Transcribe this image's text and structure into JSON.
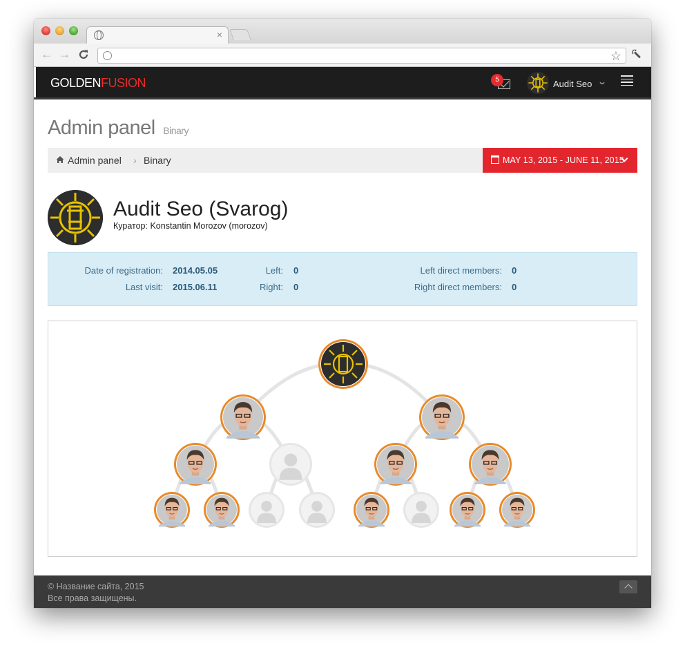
{
  "browser": {
    "tab_close": "×",
    "nav_back": "←",
    "nav_forward": "→",
    "reload": "C",
    "address": "",
    "bookmark_star": "☆",
    "wrench": "🔧"
  },
  "navbar": {
    "brand_golden": "GOLDEN",
    "brand_fusion": "FUSION",
    "brand_colors": {
      "golden": "#ffffff",
      "fusion": "#e52c2c"
    },
    "mail_count": "5",
    "user_name": "Audit Seo",
    "user_caret": "⌄",
    "icons": [
      "mail-icon",
      "avatar",
      "chevron-down-icon",
      "hamburger-icon"
    ]
  },
  "header": {
    "title": "Admin panel",
    "subtitle": "Binary"
  },
  "breadcrumb": {
    "items": [
      "Admin panel",
      "Binary"
    ],
    "separator": "›",
    "date_range": "MAY 13, 2015 - JUNE 11, 2015",
    "date_color": "#e3262d"
  },
  "profile": {
    "name": "Audit Seo (Svarog)",
    "curator": "Куратор: Konstantin Morozov (morozov)"
  },
  "info": {
    "registration_label": "Date of registration:",
    "registration_value": "2014.05.05",
    "last_visit_label": "Last visit:",
    "last_visit_value": "2015.06.11",
    "left_label": "Left:",
    "left_value": "0",
    "right_label": "Right:",
    "right_value": "0",
    "left_direct_label": "Left direct members:",
    "left_direct_value": "0",
    "right_direct_label": "Right direct members:",
    "right_direct_value": "0"
  },
  "tree": {
    "levels": [
      [
        "root"
      ],
      [
        "member",
        "member"
      ],
      [
        "member",
        "empty",
        "member",
        "member"
      ],
      [
        "member",
        "member",
        "empty",
        "empty",
        "member",
        "empty",
        "member",
        "member"
      ]
    ],
    "colors": {
      "ring": "#e88a2a",
      "empty": "#e6e6e6",
      "line": "#e4e4e4"
    }
  },
  "footer": {
    "line1": "© Название сайта, 2015",
    "line2": "Все права защищены."
  }
}
